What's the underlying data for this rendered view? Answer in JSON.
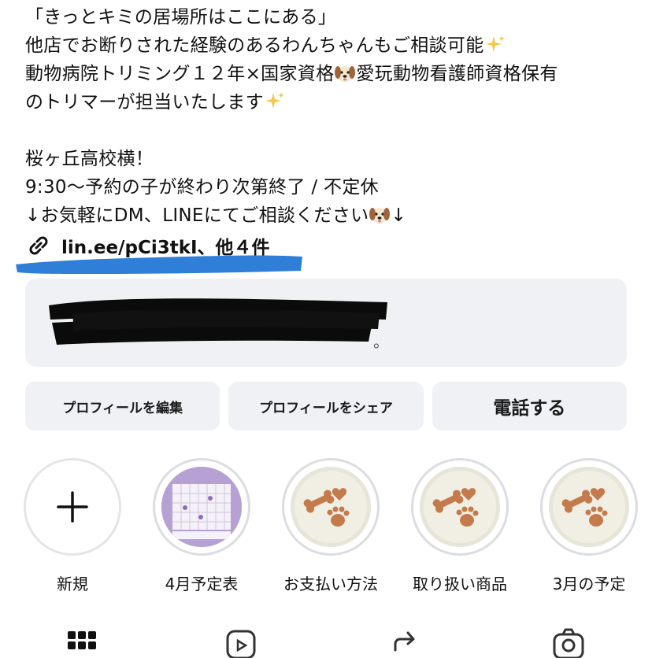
{
  "bio": {
    "line1": "「きっとキミの居場所はここにある」",
    "line2": "他店でお断りされた経験のあるわんちゃんもご相談可能",
    "line3a": "動物病院トリミング１２年×国家資格",
    "line3b": "愛玩動物看護師資格保有",
    "line4": "のトリマーが担当いたします",
    "line5": "桜ヶ丘高校横！",
    "line6": "9:30〜予約の子が終わり次第終了 / 不定休",
    "line7a": "↓お気軽にDM、LINEにてご相談ください",
    "line7b": "↓"
  },
  "link": {
    "text": "lin.ee/pCi3tkI、他４件",
    "icon": "link-icon"
  },
  "redacted_card": {
    "visible_char": "。"
  },
  "buttons": {
    "edit_profile": "プロフィールを編集",
    "share_profile": "プロフィールをシェア",
    "call": "電話する"
  },
  "highlights": [
    {
      "label": "新規"
    },
    {
      "label": "4月予定表"
    },
    {
      "label": "お支払い方法"
    },
    {
      "label": "取り扱い商品"
    },
    {
      "label": "3月の予定"
    }
  ],
  "colors": {
    "highlight_marker": "#2f7fd8",
    "card_bg": "#eff1f4",
    "ring": "#dcdde2"
  },
  "tabs": [
    "grid-icon",
    "reels-icon",
    "repost-icon",
    "tagged-icon"
  ]
}
